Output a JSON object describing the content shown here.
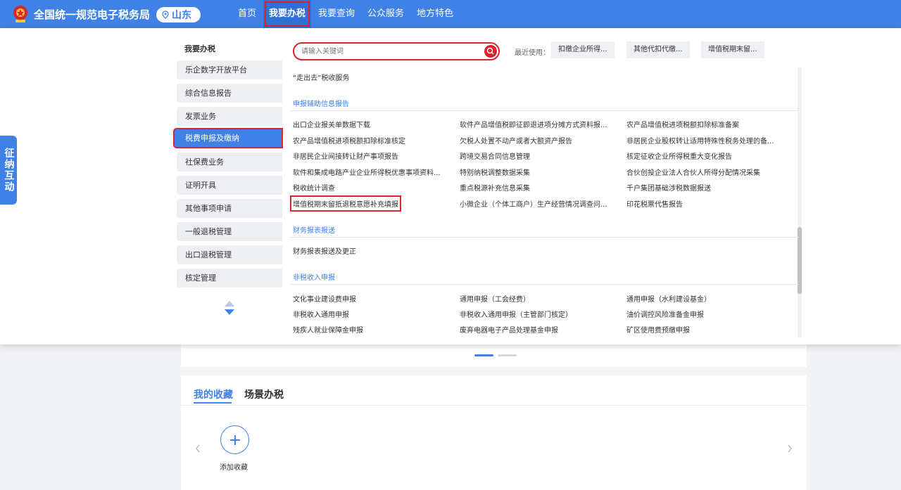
{
  "header": {
    "site_title": "全国统一规范电子税务局",
    "region": "山东",
    "nav": [
      "首页",
      "我要办税",
      "我要查询",
      "公众服务",
      "地方特色"
    ]
  },
  "side_tab": "征纳互动",
  "left_menu": {
    "heading": "我要办税",
    "items": [
      "乐企数字开放平台",
      "综合信息报告",
      "发票业务",
      "税费申报及缴纳",
      "社保费业务",
      "证明开具",
      "其他事项申请",
      "一般退税管理",
      "出口退税管理",
      "核定管理"
    ],
    "active_index": 3
  },
  "search": {
    "placeholder": "请输入关键词"
  },
  "recent": {
    "label": "最近使用：",
    "items": [
      "扣缴企业所得...",
      "其他代扣代缴...",
      "增值税期末留..."
    ]
  },
  "content": {
    "top_link": "“走出去”税收服务",
    "sections": [
      {
        "title": "申报辅助信息报告",
        "rows": [
          [
            "出口企业报关单数据下载",
            "软件产品增值税即征即退进项分摊方式资料报...",
            "农产品增值税进项税额扣除标准备案"
          ],
          [
            "农产品增值税进项税额扣除标准核定",
            "欠税人处置不动产或者大额资产报告",
            "非居民企业股权转让适用特殊性税务处理的备..."
          ],
          [
            "非居民企业间接转让财产事项报告",
            "跨境交易合同信息管理",
            "核定征收企业所得税重大变化报告"
          ],
          [
            "软件和集成电路产业企业所得税优惠事项资料...",
            "特别纳税调整数据采集",
            "合伙创投企业法人合伙人所得分配情况采集"
          ],
          [
            "税收统计调查",
            "重点税源补充信息采集",
            "千户集团基础涉税数据报送"
          ],
          [
            "增值税期末留抵退税意愿补充填报",
            "小微企业（个体工商户）生产经营情况调查问...",
            "印花税票代售报告"
          ]
        ]
      },
      {
        "title": "财务报表报送",
        "rows": [
          [
            "财务报表报送及更正"
          ]
        ]
      },
      {
        "title": "非税收入申报",
        "rows": [
          [
            "文化事业建设费申报",
            "通用申报（工会经费）",
            "通用申报（水利建设基金）"
          ],
          [
            "非税收入通用申报",
            "非税收入通用申报（主管部门核定）",
            "油价调控风险准备金申报"
          ],
          [
            "残疾人就业保障金申报",
            "废弃电器电子产品处理基金申报",
            "矿区使用费预缴申报"
          ]
        ]
      }
    ]
  },
  "lower": {
    "tabs": [
      "我的收藏",
      "场景办税"
    ],
    "add_label": "添加收藏"
  },
  "colors": {
    "primary": "#3f81e4",
    "highlight": "#d9232d"
  }
}
